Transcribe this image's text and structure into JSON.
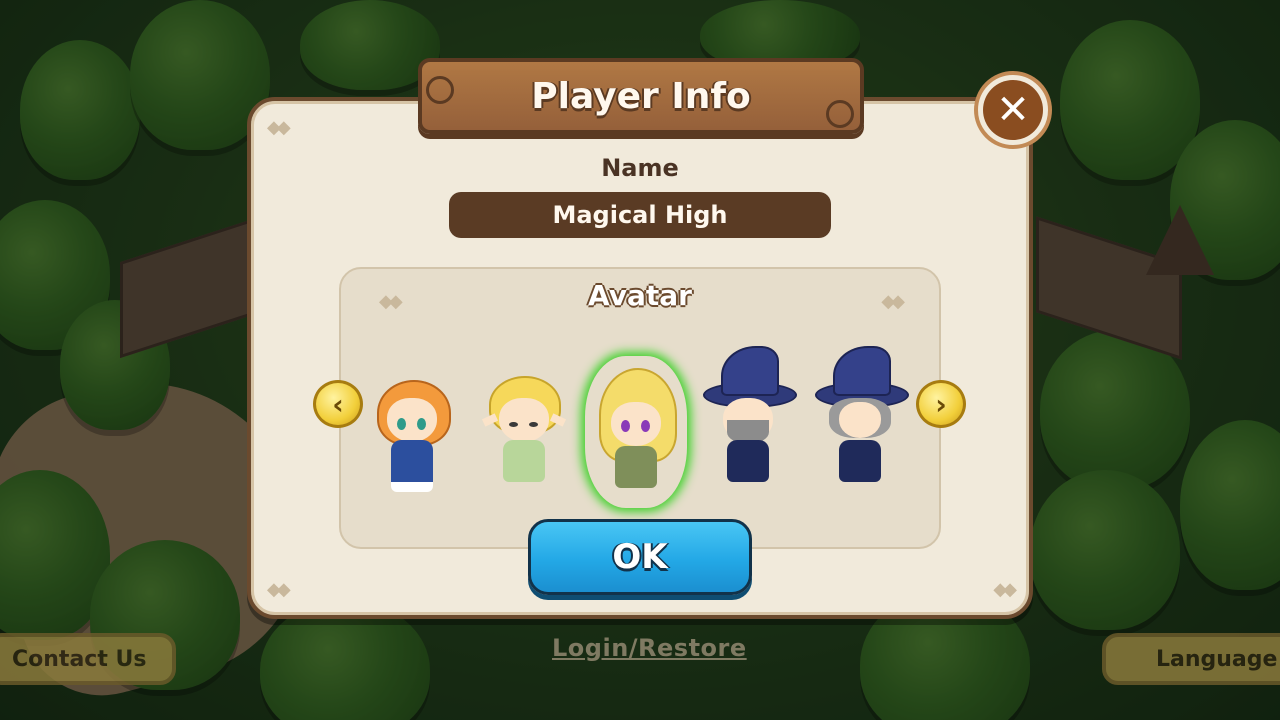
{
  "dialog": {
    "title": "Player Info",
    "close_label": "✕",
    "name_label": "Name",
    "name_value": "Magical High",
    "avatar_label": "Avatar",
    "ok_label": "OK",
    "prev_icon": "chevron-left-icon",
    "next_icon": "chevron-right-icon"
  },
  "avatars": [
    {
      "id": "girl-orange-hair",
      "selected": false
    },
    {
      "id": "elf-boy-blond",
      "selected": false
    },
    {
      "id": "elf-girl-blonde",
      "selected": true
    },
    {
      "id": "wizard-bearded",
      "selected": false
    },
    {
      "id": "wizard-grey-hair",
      "selected": false
    }
  ],
  "background": {
    "contact_label": "Contact Us",
    "login_label": "Login/Restore",
    "language_label": "Language"
  },
  "colors": {
    "panel": "#f1eadb",
    "banner": "#a56d3f",
    "name_field": "#5a3b24",
    "ok_button": "#23a8e6",
    "selection_glow": "#3fd12a",
    "arrow": "#f2cf3a"
  }
}
